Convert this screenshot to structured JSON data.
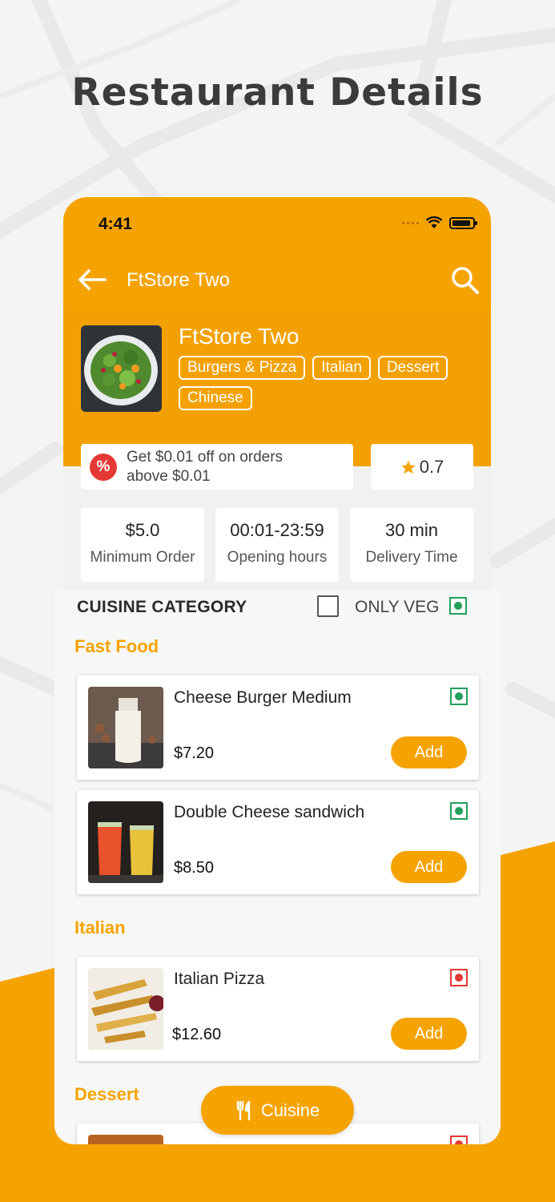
{
  "page": {
    "heading": "Restaurant Details"
  },
  "status_bar": {
    "time": "4:41"
  },
  "app_bar": {
    "title": "FtStore Two",
    "back_icon": "arrow-left-icon",
    "search_icon": "search-icon"
  },
  "store": {
    "name": "FtStore Two",
    "tags": [
      "Burgers & Pizza",
      "Italian",
      "Dessert",
      "Chinese"
    ],
    "offer": {
      "icon": "percent-icon",
      "text": "Get $0.01 off on orders above $0.01"
    },
    "rating": "0.7",
    "stats": [
      {
        "value": "$5.0",
        "label": "Minimum Order"
      },
      {
        "value": "00:01-23:59",
        "label": "Opening hours"
      },
      {
        "value": "30 min",
        "label": "Delivery Time"
      }
    ]
  },
  "menu": {
    "category_title": "CUISINE CATEGORY",
    "only_veg_label": "ONLY VEG",
    "only_veg_checked": false,
    "sections": [
      {
        "title": "Fast Food",
        "items": [
          {
            "name": "Cheese Burger Medium",
            "price": "$7.20",
            "add_label": "Add",
            "veg": true
          },
          {
            "name": "Double Cheese sandwich",
            "price": "$8.50",
            "add_label": "Add",
            "veg": true
          }
        ]
      },
      {
        "title": "Italian",
        "items": [
          {
            "name": "Italian Pizza",
            "price": "$12.60",
            "add_label": "Add",
            "veg": false
          }
        ]
      },
      {
        "title": "Dessert",
        "items": []
      }
    ]
  },
  "fab": {
    "label": "Cuisine",
    "icon": "fork-knife-icon"
  },
  "colors": {
    "accent": "#f5a300",
    "veg": "#22a05a",
    "nonveg": "#e53935"
  }
}
